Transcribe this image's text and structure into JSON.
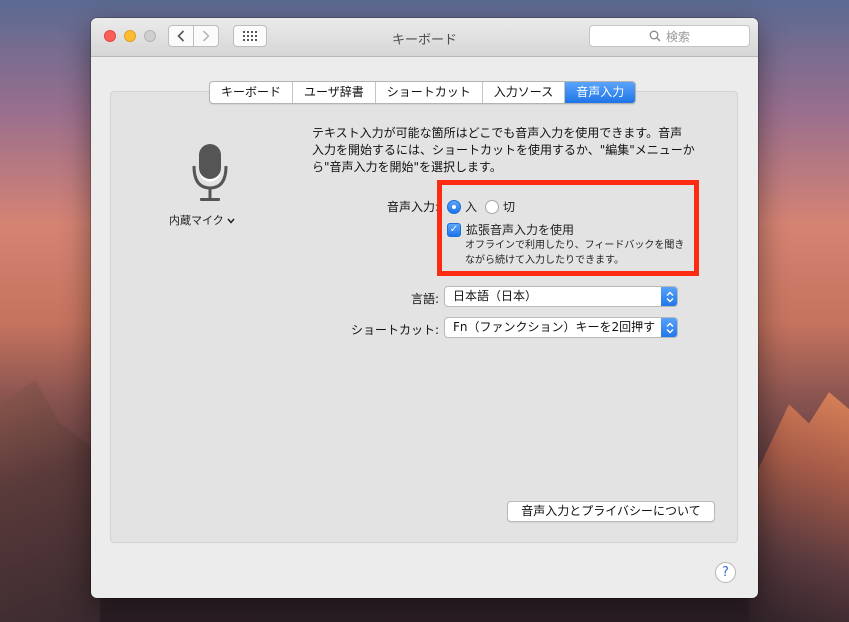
{
  "window": {
    "title": "キーボード"
  },
  "search": {
    "placeholder": "検索"
  },
  "tabs": [
    {
      "label": "キーボード",
      "active": false
    },
    {
      "label": "ユーザ辞書",
      "active": false
    },
    {
      "label": "ショートカット",
      "active": false
    },
    {
      "label": "入力ソース",
      "active": false
    },
    {
      "label": "音声入力",
      "active": true
    }
  ],
  "mic": {
    "label": "内蔵マイク",
    "icon": "microphone-icon"
  },
  "description": [
    "テキスト入力が可能な箇所はどこでも音声入力を使用できます。音声",
    "入力を開始するには、ショートカットを使用するか、\"編集\"メニューか",
    "ら\"音声入力を開始\"を選択します。"
  ],
  "dictation": {
    "label": "音声入力:",
    "on_label": "入",
    "off_label": "切",
    "selected": "入",
    "enhanced": {
      "label": "拡張音声入力を使用",
      "checked": true,
      "help_line1": "オフラインで利用したり、フィードバックを聞き",
      "help_line2": "ながら続けて入力したりできます。"
    }
  },
  "language": {
    "label": "言語:",
    "value": "日本語（日本）"
  },
  "shortcut": {
    "label": "ショートカット:",
    "value": "Fn（ファンクション）キーを2回押す"
  },
  "privacy_button": "音声入力とプライバシーについて",
  "help_button": "?",
  "colors": {
    "accent": "#1f75e8",
    "highlight_box": "#ff2a12"
  }
}
